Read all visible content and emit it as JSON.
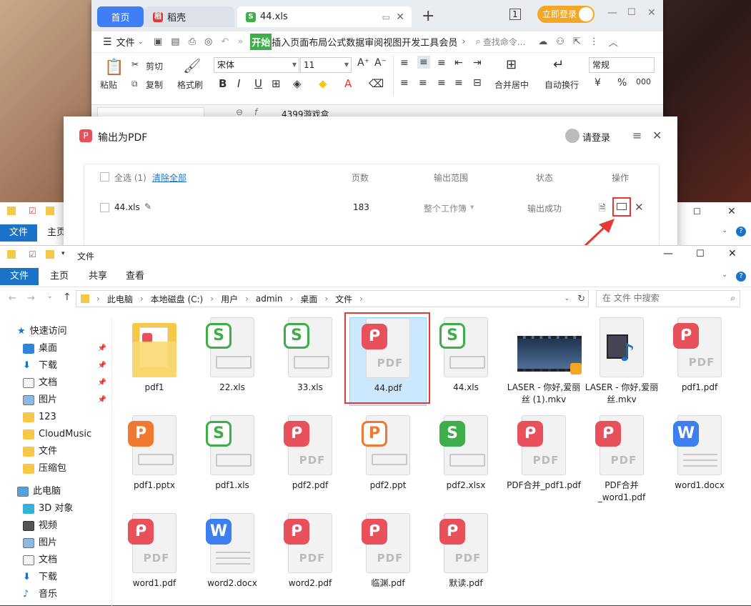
{
  "wps": {
    "tab_home": "首页",
    "tab_daoke": "稻壳",
    "tab_file": "44.xls",
    "login": "立即登录",
    "menu": {
      "file": "文件",
      "start": "开始",
      "tabs": [
        "插入",
        "页面布局",
        "公式",
        "数据",
        "审阅",
        "视图",
        "开发工具",
        "会员"
      ],
      "search": "查找命令..."
    },
    "ribbon": {
      "paste": "粘贴",
      "cut": "剪切",
      "copy": "复制",
      "format_brush": "格式刷",
      "font": "宋体",
      "size": "11",
      "merge": "合并居中",
      "wrap": "自动换行",
      "number_format": "常规"
    },
    "formula_value": "4399游戏盒"
  },
  "dialog": {
    "title": "输出为PDF",
    "user": "请登录",
    "select_all": "全选 (1)",
    "clear_all": "清除全部",
    "col_pages": "页数",
    "col_range": "输出范围",
    "col_status": "状态",
    "col_action": "操作",
    "row": {
      "name": "44.xls",
      "pages": "183",
      "range": "整个工作簿",
      "status": "输出成功"
    }
  },
  "explorer_back": {
    "file_tab": "文件",
    "home_tab": "主页"
  },
  "explorer": {
    "title": "文件",
    "ribbon_tabs": [
      "文件",
      "主页",
      "共享",
      "查看"
    ],
    "path": [
      "此电脑",
      "本地磁盘 (C:)",
      "用户",
      "admin",
      "桌面",
      "文件"
    ],
    "search_placeholder": "在 文件 中搜索",
    "nav": {
      "quick_access": "快速访问",
      "quick": [
        "桌面",
        "下载",
        "文档",
        "图片",
        "123",
        "CloudMusic",
        "文件",
        "压缩包"
      ],
      "this_pc": "此电脑",
      "pc": [
        "3D 对象",
        "视频",
        "图片",
        "文档",
        "下载",
        "音乐"
      ]
    },
    "files": [
      {
        "name": "pdf1",
        "type": "folder"
      },
      {
        "name": "22.xls",
        "type": "xls"
      },
      {
        "name": "33.xls",
        "type": "xls"
      },
      {
        "name": "44.pdf",
        "type": "pdf",
        "selected": true
      },
      {
        "name": "44.xls",
        "type": "xls"
      },
      {
        "name": "LASER - 你好,爱丽丝 (1).mkv",
        "type": "video"
      },
      {
        "name": "LASER - 你好,爱丽丝.mkv",
        "type": "media"
      },
      {
        "name": "pdf1.pdf",
        "type": "pdf"
      },
      {
        "name": "pdf1.pptx",
        "type": "pptx"
      },
      {
        "name": "pdf1.xls",
        "type": "xls"
      },
      {
        "name": "pdf2.pdf",
        "type": "pdf"
      },
      {
        "name": "pdf2.ppt",
        "type": "ppt"
      },
      {
        "name": "pdf2.xlsx",
        "type": "xlsx"
      },
      {
        "name": "PDF合并_pdf1.pdf",
        "type": "pdf"
      },
      {
        "name": "PDF合并_word1.pdf",
        "type": "pdf"
      },
      {
        "name": "word1.docx",
        "type": "docx"
      },
      {
        "name": "word1.pdf",
        "type": "pdf"
      },
      {
        "name": "word2.docx",
        "type": "docx"
      },
      {
        "name": "word2.pdf",
        "type": "pdf"
      },
      {
        "name": "临渊.pdf",
        "type": "pdf"
      },
      {
        "name": "默读.pdf",
        "type": "pdf"
      }
    ]
  },
  "colors": {
    "pdf": "#e8505b",
    "xls": "#3dae49",
    "ppt": "#f0792f",
    "doc": "#3e7ff0",
    "accent": "#1a73c9",
    "highlight": "#e53935"
  }
}
